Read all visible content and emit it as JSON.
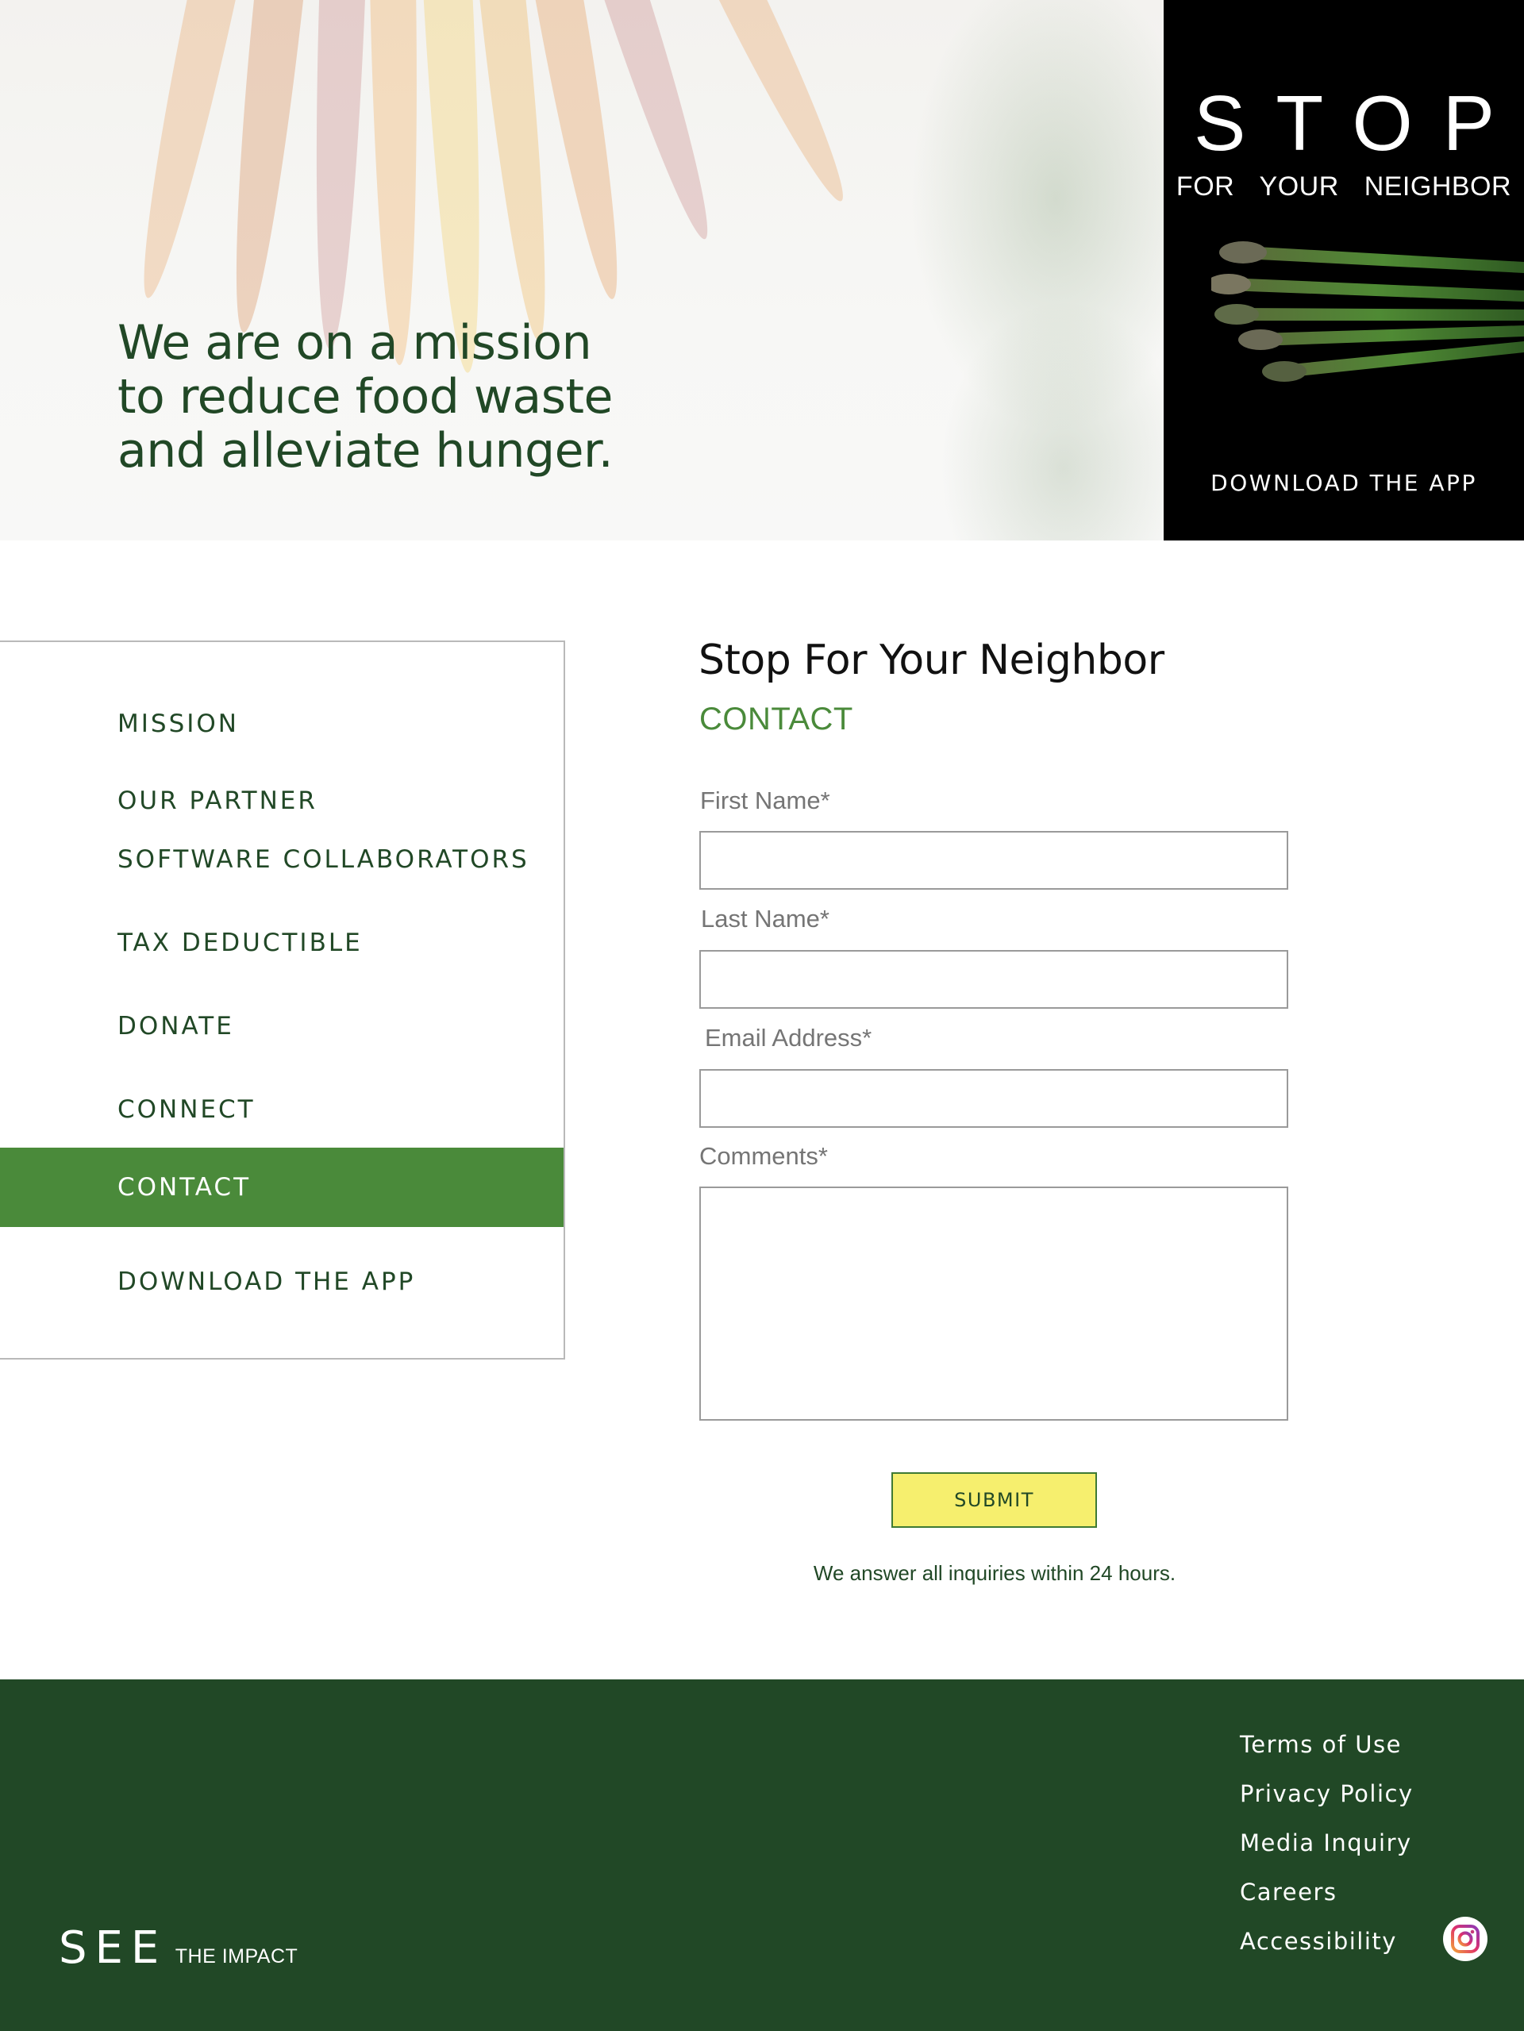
{
  "hero": {
    "lines": [
      "We are on a mission",
      "to reduce food waste",
      "and alleviate hunger."
    ]
  },
  "promo": {
    "title": "STOP",
    "subtitle": "FOR YOUR NEIGHBOR",
    "cta": "DOWNLOAD THE APP"
  },
  "nav": {
    "items": [
      {
        "label": "MISSION",
        "active": false
      },
      {
        "label": "OUR PARTNER",
        "active": false
      },
      {
        "label": "SOFTWARE COLLABORATORS",
        "active": false
      },
      {
        "label": "TAX DEDUCTIBLE",
        "active": false
      },
      {
        "label": "DONATE",
        "active": false
      },
      {
        "label": "CONNECT",
        "active": false
      },
      {
        "label": "CONTACT",
        "active": true
      },
      {
        "label": "DOWNLOAD THE APP",
        "active": false
      }
    ]
  },
  "form": {
    "org_title": "Stop For Your Neighbor",
    "heading": "CONTACT",
    "first_name": {
      "label": "First Name*",
      "value": ""
    },
    "last_name": {
      "label": "Last Name*",
      "value": ""
    },
    "email": {
      "label": "Email Address*",
      "value": ""
    },
    "comments": {
      "label": "Comments*",
      "value": ""
    },
    "submit_label": "SUBMIT",
    "note": "We answer all inquiries within 24 hours."
  },
  "footer": {
    "brand_big": "SEE",
    "brand_small": "THE IMPACT",
    "links": [
      "Terms of Use",
      "Privacy Policy",
      "Media Inquiry",
      "Careers",
      "Accessibility"
    ],
    "social_icon": "instagram-icon"
  },
  "colors": {
    "brand_green": "#214826",
    "accent_green": "#4a8a3a",
    "submit_yellow": "#f6ef6e"
  }
}
